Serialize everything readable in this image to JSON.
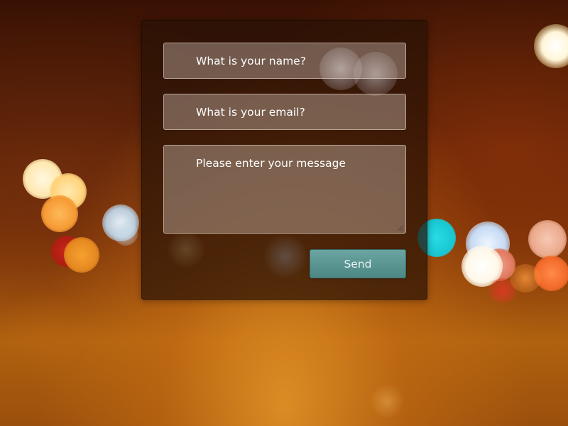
{
  "form": {
    "name_placeholder": "What is your name?",
    "email_placeholder": "What is your email?",
    "message_placeholder": "Please enter your message",
    "send_label": "Send"
  },
  "colors": {
    "send_button": "#5b9894",
    "background_glow": "#c7751a"
  }
}
